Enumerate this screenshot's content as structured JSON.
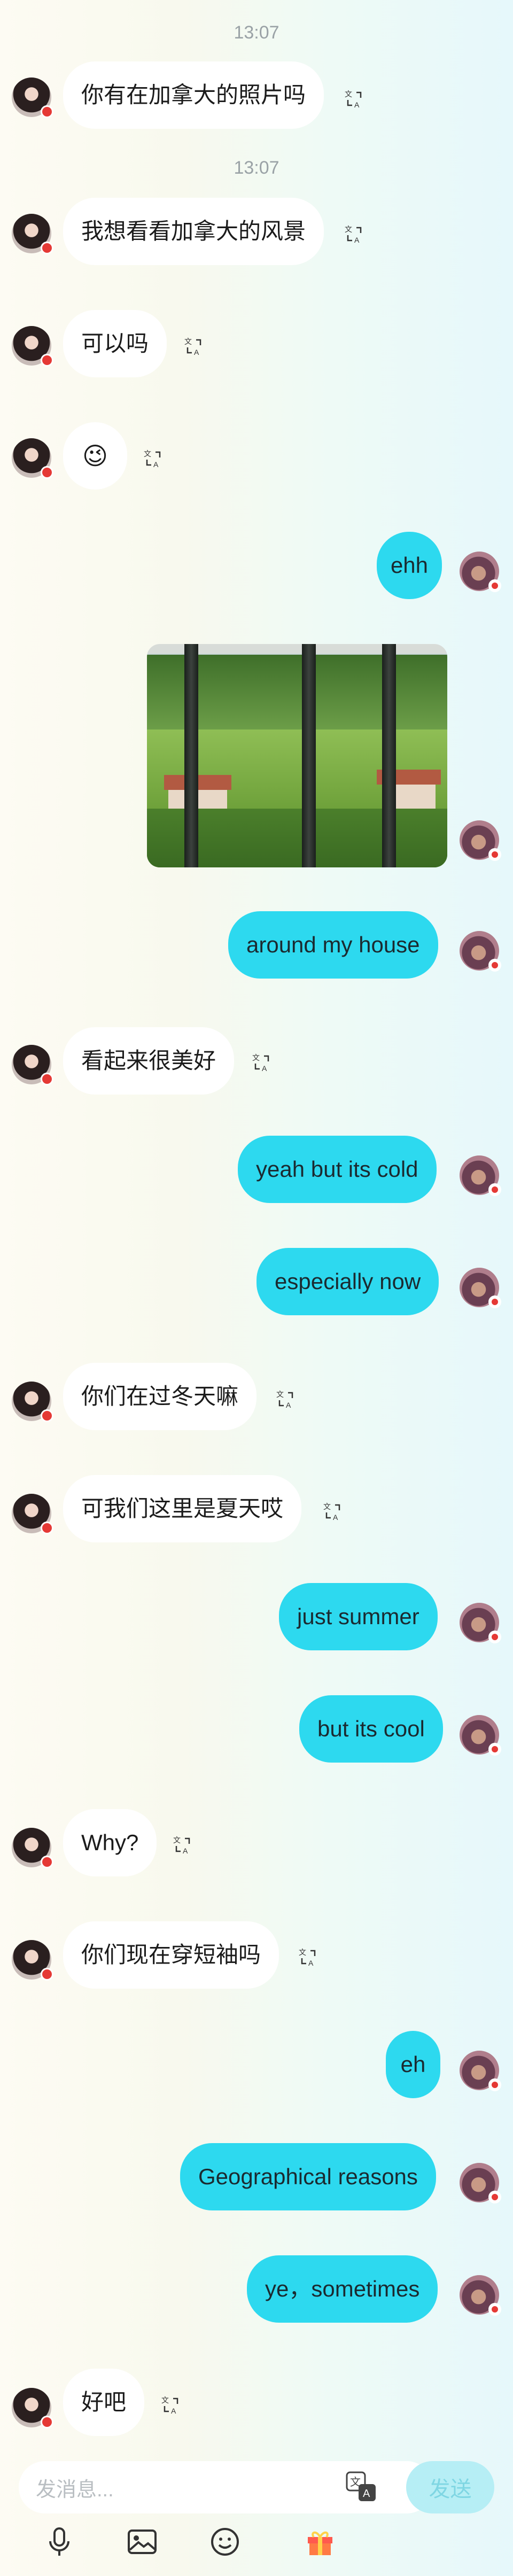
{
  "chat": {
    "timestamps": [
      "13:07",
      "13:07"
    ],
    "messages": [
      {
        "side": "left",
        "text": "你有在加拿大的照片吗"
      },
      {
        "side": "left",
        "text": "我想看看加拿大的风景"
      },
      {
        "side": "left",
        "text": "可以吗"
      },
      {
        "side": "left",
        "text": "😉"
      },
      {
        "side": "right",
        "text": "ehh"
      },
      {
        "side": "right",
        "type": "image",
        "alt": "Photo through window bars of a green park with houses"
      },
      {
        "side": "right",
        "text": "around my house"
      },
      {
        "side": "left",
        "text": "看起来很美好"
      },
      {
        "side": "right",
        "text": "yeah but its cold"
      },
      {
        "side": "right",
        "text": "especially now"
      },
      {
        "side": "left",
        "text": "你们在过冬天嘛"
      },
      {
        "side": "left",
        "text": "可我们这里是夏天哎"
      },
      {
        "side": "right",
        "text": "just summer"
      },
      {
        "side": "right",
        "text": "but its cool"
      },
      {
        "side": "left",
        "text": "Why?"
      },
      {
        "side": "left",
        "text": "你们现在穿短袖吗"
      },
      {
        "side": "right",
        "text": "eh"
      },
      {
        "side": "right",
        "text": "Geographical reasons"
      },
      {
        "side": "right",
        "text": "ye，sometimes"
      },
      {
        "side": "left",
        "text": "好吧"
      }
    ]
  },
  "composer": {
    "placeholder": "发消息...",
    "send_label": "发送",
    "icons": [
      "microphone-icon",
      "image-icon",
      "emoji-icon",
      "gift-icon",
      "translate-icon"
    ]
  },
  "colors": {
    "accent_bubble": "#2dd9ef",
    "incoming_bubble": "#ffffff",
    "send_button_disabled": "#b6eef5"
  }
}
